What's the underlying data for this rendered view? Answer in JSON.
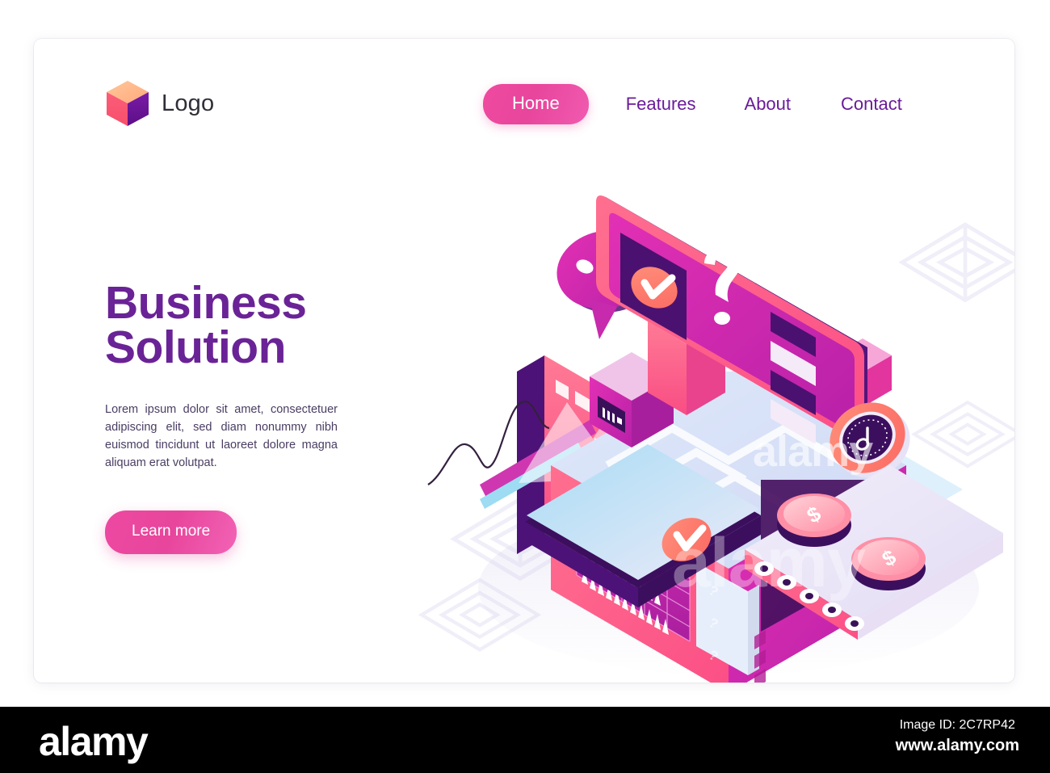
{
  "card": {
    "background": "#ffffff"
  },
  "header": {
    "brand": {
      "name": "Logo",
      "icon": "cube-logo-icon",
      "colors": {
        "top": "#ffb081",
        "left": "#f9566f",
        "right": "#6a1b9a"
      }
    },
    "nav": [
      {
        "label": "Home",
        "active": true
      },
      {
        "label": "Features",
        "active": false
      },
      {
        "label": "About",
        "active": false
      },
      {
        "label": "Contact",
        "active": false
      }
    ],
    "active_color": "#e8459c",
    "link_color": "#6a1b9a"
  },
  "hero": {
    "title_line1": "Business",
    "title_line2": "Solution",
    "title_color": "#6a2396",
    "paragraph": "Lorem ipsum dolor sit amet, consectetuer adipiscing elit, sed diam nonummy nibh euismod tincidunt ut laoreet dolore magna aliquam erat volutpat.",
    "cta_label": "Learn more",
    "cta_color": "#e8459c"
  },
  "illustration": {
    "name": "isometric-business-solution-illustration",
    "elements": [
      "monitor-screen-with-checkmark-and-question-mark",
      "speech-bubble-with-three-dots",
      "pedestal-cube-left",
      "pedestal-cube-right",
      "main-platform-box",
      "bar-chart-panel",
      "question-card-stack",
      "timer-gauge-dial",
      "dollar-coin-1",
      "dollar-coin-2",
      "conveyor-belt",
      "mobile-phone-with-line-graph",
      "tablet-slab-with-checkmark",
      "maze-pattern-background"
    ],
    "palette": {
      "pink": "#ff5f87",
      "magenta": "#d92bb0",
      "purple_dark": "#4d1466",
      "purple": "#8a1fa8",
      "coral": "#ff7d6e",
      "light_blue": "#bfe4f8",
      "lavender": "#e6e1f5",
      "white": "#ffffff"
    }
  },
  "watermark": {
    "logo": "alamy",
    "image_id": "Image ID: 2C7RP42",
    "url": "www.alamy.com",
    "overlay_word": "alamy"
  }
}
